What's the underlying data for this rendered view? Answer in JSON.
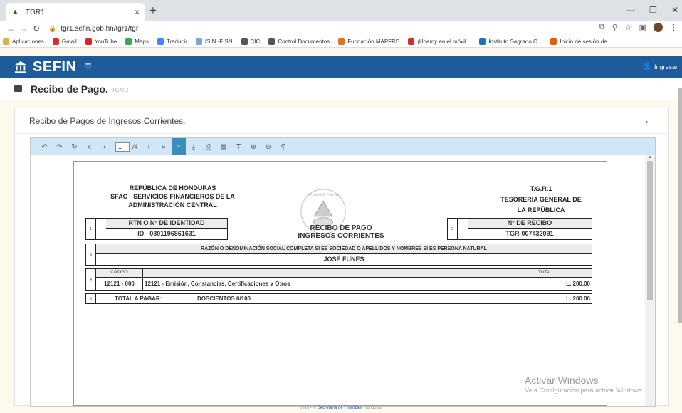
{
  "browser": {
    "tab_title": "TGR1",
    "tab_close": "×",
    "new_tab": "+",
    "url": "tgr1.sefin.gob.hn/tgr1/tgr",
    "bookmarks": [
      {
        "label": "Aplicaciones",
        "color": "#e0b040"
      },
      {
        "label": "Gmail",
        "color": "#d93025"
      },
      {
        "label": "YouTube",
        "color": "#e62117"
      },
      {
        "label": "Maps",
        "color": "#34a853"
      },
      {
        "label": "Traducir",
        "color": "#4285f4"
      },
      {
        "label": "ISIN -FISN",
        "color": "#7aa7d8"
      },
      {
        "label": "CIC",
        "color": "#555555"
      },
      {
        "label": "Control Documentos",
        "color": "#555555"
      },
      {
        "label": "Fundación MAPFRE",
        "color": "#e07020"
      },
      {
        "label": "¡Udemy en el móvil...",
        "color": "#d03030"
      },
      {
        "label": "Instituto Sagrado C...",
        "color": "#1a73b8"
      },
      {
        "label": "Inicio de sesión de...",
        "color": "#e65c00"
      }
    ]
  },
  "app": {
    "brand": "SEFIN",
    "login_label": "Ingresar",
    "page_title": "Recibo de Pago.",
    "page_code": "TGR-1",
    "card_title": "Recibo de Pagos de Ingresos Corrientes."
  },
  "viewer": {
    "page_current": "1",
    "page_total": "/4"
  },
  "receipt": {
    "left_header": [
      "REPÚBLICA DE HONDURAS",
      "SFAC - SERVICIOS FINANCIEROS DE LA",
      "ADMINISTRACIÓN CENTRAL"
    ],
    "right_header": [
      "T.G.R.1",
      "TESORERIA GENERAL DE",
      "LA REPÚBLICA"
    ],
    "seal_text": "Secretaría de Finanzas",
    "title_line1": "RECIBO DE PAGO",
    "title_line2": "INGRESOS CORRIENTES",
    "box1": {
      "num": "1",
      "label": "RTN O N° DE IDENTIDAD",
      "value": "ID - 0801196861631"
    },
    "box2": {
      "num": "2",
      "label": "N° DE RECIBO",
      "value": "TGR-007432091"
    },
    "box3": {
      "num": "3",
      "label": "RAZÓN O DENOMINACIÓN SOCIAL COMPLETA SI ES SOCIEDAD O APELLIDOS Y NOMBRES SI ES PERSONA NATURAL",
      "value": "JOSÉ FUNES"
    },
    "box4": {
      "num": "4",
      "col_code": "CÓDIGO",
      "col_total": "TOTAL",
      "code": "12121 - 000",
      "description": "12121 - Emisión, Constancias, Certificaciones y Otros",
      "amount": "L. 200.00"
    },
    "box5": {
      "num": "5",
      "label": "TOTAL A PAGAR:",
      "words": "DOSCIENTOS 0/100.",
      "amount": "L. 200.00"
    }
  },
  "overlay": {
    "activate_title": "Activar Windows",
    "activate_sub": "Ve a Configuración para activar Windows."
  },
  "footer": {
    "year": "2019 - ©",
    "link": "Secretaría de Finanzas",
    "country": ", Honduras"
  }
}
